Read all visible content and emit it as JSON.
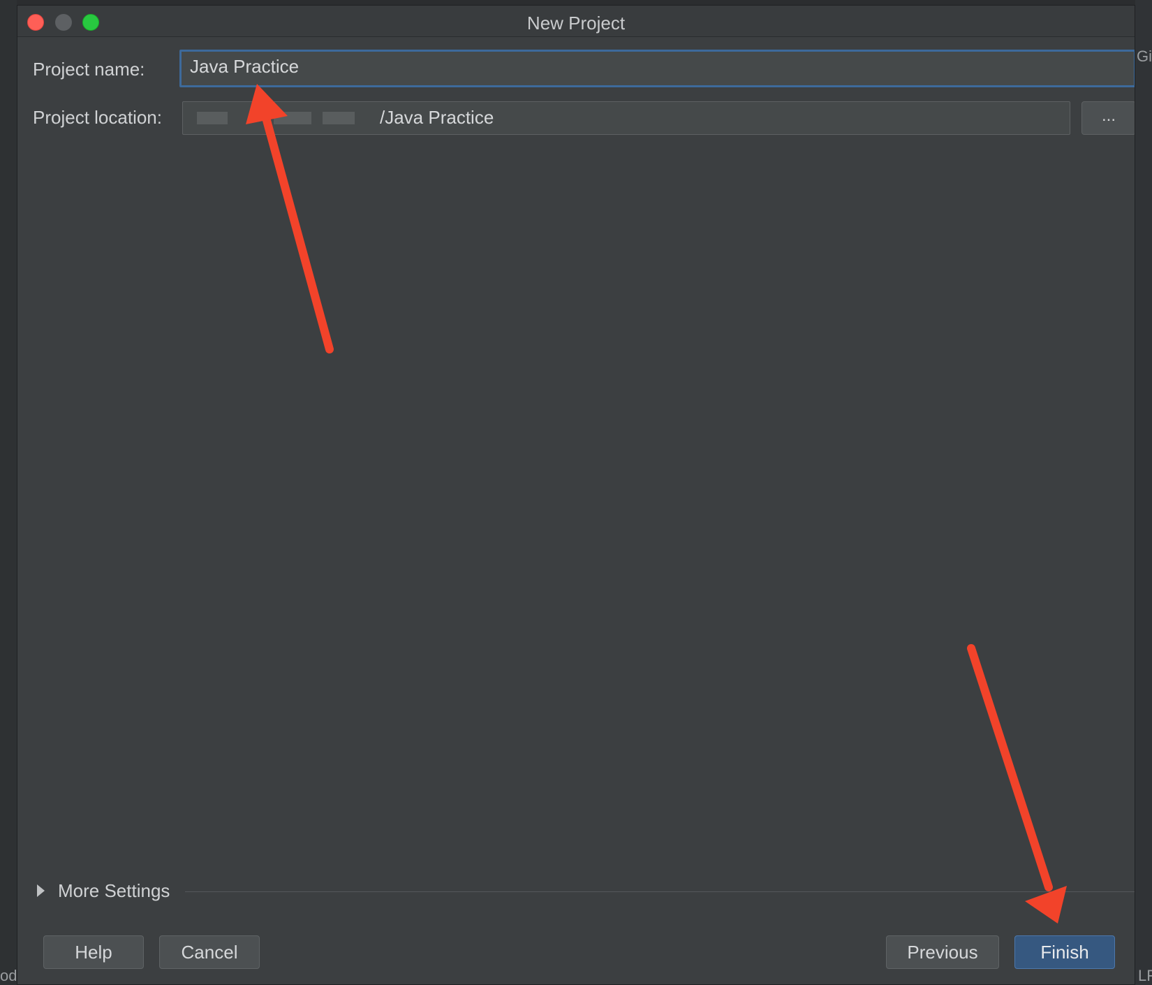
{
  "window": {
    "title": "New Project"
  },
  "background": {
    "right_top_fragment": "Git",
    "left_bottom_fragment": "od",
    "right_bottom_fragment": "LF"
  },
  "form": {
    "project_name": {
      "label": "Project name:",
      "value": "Java Practice"
    },
    "project_location": {
      "label": "Project location:",
      "value_visible_suffix": "/Java Practice",
      "browse_label": "..."
    }
  },
  "more_settings": {
    "label": "More Settings"
  },
  "footer": {
    "help_label": "Help",
    "cancel_label": "Cancel",
    "previous_label": "Previous",
    "finish_label": "Finish"
  },
  "colors": {
    "annotation_arrow": "#f2432a",
    "primary_button": "#365880",
    "focus_border": "#3d6a9b"
  }
}
